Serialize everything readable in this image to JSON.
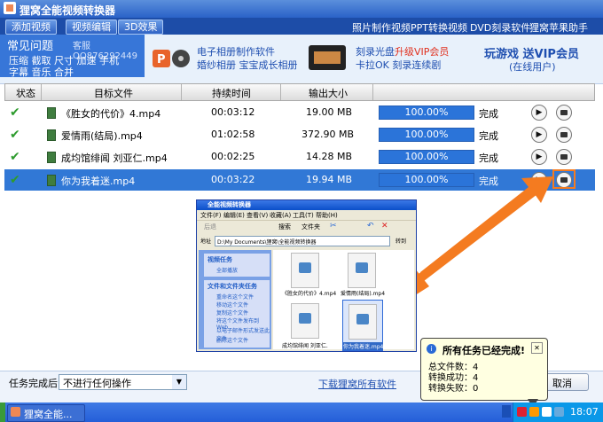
{
  "app": {
    "title": "狸窝全能视频转换器"
  },
  "toolbar": {
    "buttons": [
      "添加视频",
      "视频编辑",
      "3D效果"
    ],
    "links": [
      "照片制作视频",
      "PPT转换视频",
      "DVD刻录软件",
      "狸窝苹果助手"
    ]
  },
  "banner": {
    "faq_title": "常见问题",
    "qq": "客服QQ876292449",
    "faq_row1": "压缩 截取 尺寸 加速 手机",
    "faq_row2": "字幕 音乐 合并",
    "promo1_line1": "电子相册制作软件",
    "promo1_line2": "婚纱相册 宝宝成长相册",
    "promo2_line1a": "刻录光盘",
    "promo2_line1b": "升级VIP会员",
    "promo2_line2": "卡拉OK 刻录连续剧",
    "promo3_line1": "玩游戏 送VIP会员",
    "promo3_line2": "(在线用户)"
  },
  "table": {
    "headers": [
      "状态",
      "目标文件",
      "持续时间",
      "输出大小"
    ],
    "rows": [
      {
        "name": "《胜女的代价》4.mp4",
        "duration": "00:03:12",
        "size": "19.00 MB",
        "progress": "100.00%",
        "status": "完成",
        "progress_fraction": 1.0
      },
      {
        "name": "爱情雨(结局).mp4",
        "duration": "01:02:58",
        "size": "372.90 MB",
        "progress": "100.00%",
        "status": "完成",
        "progress_fraction": 1.0
      },
      {
        "name": "成均馆绯闻 刘亚仁.mp4",
        "duration": "00:02:25",
        "size": "14.28 MB",
        "progress": "100.00%",
        "status": "完成",
        "progress_fraction": 1.0
      },
      {
        "name": "你为我着迷.mp4",
        "duration": "00:03:22",
        "size": "19.94 MB",
        "progress": "100.00%",
        "status": "完成",
        "progress_fraction": 1.0
      }
    ]
  },
  "explorer": {
    "title": "全能视频转换器",
    "menu": [
      "文件(F)",
      "编辑(E)",
      "查看(V)",
      "收藏(A)",
      "工具(T)",
      "帮助(H)"
    ],
    "back": "后退",
    "search": "搜索",
    "folders": "文件夹",
    "address_label": "地址",
    "address": "D:\\My Documents\\狸窝\\全能视频转换器",
    "go": "转到",
    "pane1_title": "视频任务",
    "pane1_item": "全部播放",
    "pane2_title": "文件和文件夹任务",
    "pane2_items": [
      "重命名这个文件",
      "移动这个文件",
      "复制这个文件",
      "将这个文件发布到 Web",
      "以电子邮件形式发送此文件",
      "删除这个文件"
    ],
    "files": [
      "《胜女的代价》4.mp4",
      "爱情雨(结局).mp4",
      "成均馆绯闻 刘亚仁.",
      "你为我着迷.mp4"
    ]
  },
  "bottom": {
    "after_label": "任务完成后:",
    "after_value": "不进行任何操作",
    "download_link": "下载狸窝所有软件",
    "cancel": "取消"
  },
  "popup": {
    "title": "所有任务已经完成!",
    "line1": "总文件数：4",
    "line2": "转换成功：4",
    "line3": "转换失败：0"
  },
  "taskbar": {
    "app_label": "狸窝全能...",
    "clock": "18:07"
  },
  "colors": {
    "accent": "#3178d6",
    "progress": "#2b74d9",
    "highlight": "#f47b20",
    "vip_red": "#e0301e"
  }
}
